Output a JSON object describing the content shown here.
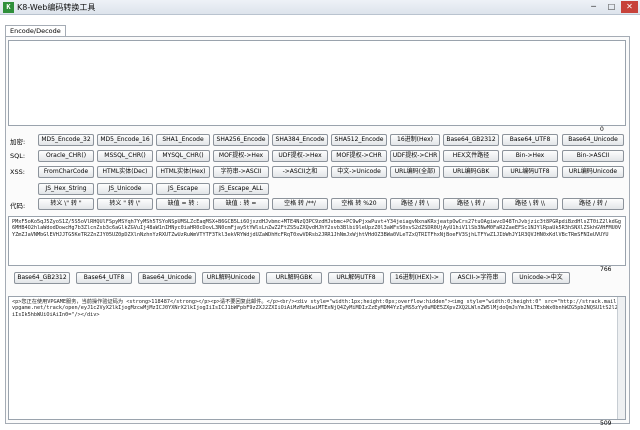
{
  "window": {
    "title": "K8-Web编码转换工具",
    "icon": "app-icon",
    "minimize": "─",
    "maximize": "□",
    "close": "✕"
  },
  "tab": "Encode/Decode",
  "counts": {
    "input": "0",
    "output": "766",
    "result": "509"
  },
  "rows": {
    "encrypt": {
      "label": "加密:",
      "buttons": [
        "MD5_Encode_32",
        "MD5_Encode_16",
        "SHA1_Encode",
        "SHA256_Encode",
        "SHA384_Encode",
        "SHA512_Encode",
        "16进制(Hex)",
        "Base64_GB2312",
        "Base64_UTF8",
        "Base64_Unicode"
      ]
    },
    "sql": {
      "label": "SQL:",
      "buttons": [
        "Oracle_CHR()",
        "MSSQL_CHR()",
        "MYSQL_CHR()",
        "MOF提权->Hex",
        "UDF提权->Hex",
        "MOF提权->CHR",
        "UDF提权->CHR",
        "HEX文件路径",
        "Bin->Hex",
        "Bin->ASCII"
      ]
    },
    "xss": {
      "label": "XSS:",
      "buttons": [
        "FromCharCode",
        "HTML实体(Dec)",
        "HTML实体(Hex)",
        "字符串->ASCII",
        "->ASCII之和",
        "中文->Unicode",
        "URL编码(全部)",
        "URL编码GBK",
        "URL编码UTF8",
        "URL编码Unicode"
      ]
    },
    "xss2": {
      "buttons": [
        "JS_Hex_String",
        "JS_Unicode",
        "JS_Escape",
        "JS_Escape_ALL"
      ]
    },
    "code": {
      "label": "代码:",
      "buttons": [
        "转义 \\\" 转 \"",
        "转义 \" 转 \\\"",
        "缺值 = 转 :",
        "缺值 : 转 =",
        "空格 转 /**/",
        "空格 转 %20",
        "路径 / 转 \\",
        "路径 \\ 转 /",
        "路径 \\ 转 \\\\",
        "路径 / 转 /"
      ]
    },
    "decode": {
      "buttons": [
        "Base64_GB2312",
        "Base64_UTF8",
        "Base64_Unicode",
        "URL解码Unicode",
        "URL解码GBK",
        "URL解码UTF8",
        "16进制(HEX)->",
        "ASCII->字符串",
        "Unicode->中文"
      ]
    }
  },
  "output_text": "PMxF5oKo5qJ5ZyoS1Z/5S5oVlRHQUlFSpyMSYqh7YyMSh5TSYoNSpUMSLZcEaqMSX+B6GCB5Li6OjxzdHJvbmc+MTE4NzQ3PC9zdHJvbmc+PC9wPjxwPuvt+Y34jeiagvNxnaKRxjeatpOwCrs27tuOAgiwvcD48TnJvbjzic3t8PGRpdiBzdHlsZT0iZ2lkdGg6MHB4O2hlaWdodDowcHg7b3ZlcnZsb3c6aGlkZGVuIj48aW1nIHNyc0iaHR0cDovL3N0cmFjay5tYWlsLnZwZ2FtZS5uZXQvdHJhY2svb3Blbi9leUpzZ0l3aWFsS0xvS2dZSDR0UjAyU1hiV1lSb3NwM0FaR2ZaeEFSc1NJYlRpaUk5R3hSNXlZSkhGVHFMU0VYZmZJaVNMbGlEVHJJTG5KeTR2ZnZJY05UZ0pDZXlnNzhnYzRXUTZwUzRuWmVTYTF3Tkl3ekVRYWdjdUZaWDhHcFRqT0xwVDRsb2JRR1JhNmJxWjhtVHdOZ3BWa0VLeTZxQTRITFhxNjBoeFV3SjhLTFYwZ1JIbWhJY1R3QVJHN0xKdlVBcTRmSFNIeUVUYU",
  "result_text": "<p>您正在使用VPGAME服务，当前操作验证码为 <strong>118487</strong></p><p>请不要回复此邮件。</p><br/><div style=\"width:1px;height:0px;overflow:hidden\"><img style=\"width:0;height:0\" src=\"http://strack.mail.vpgame.net/track/open/eyJ1c2VyX2lkIjogMzcwMjMzICJ0YXNrX2lkIjogIiIsICJ1bWFpbF9zZXJ2ZXIiOiAiMzMzMiwiMTExNjQ4ZyMiMDIzZzEyMDM4YzIyMS5zYy0uMDE5ZXpvZXQ2LWlnZW5lMjdoQmJsYmJhLTExbWx0bnhWZG5pb2NQSU1tS2l2NiIsIk5hbWUiOiAiIn0=\"/></div>",
  "colors": {
    "titlebar": "#dde4ec",
    "button": "#e2e5e8",
    "border": "#8c939b",
    "icon": "#2f8f3a"
  }
}
